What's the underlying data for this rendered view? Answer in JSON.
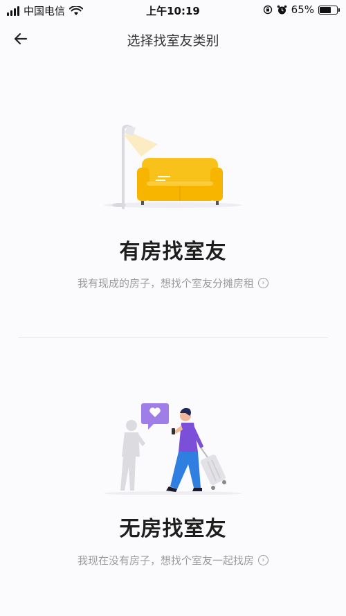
{
  "status_bar": {
    "carrier": "中国电信",
    "time": "上午10:19",
    "battery": "65%",
    "battery_level": 0.65
  },
  "nav": {
    "title": "选择找室友类别",
    "back_icon": "arrow-left-icon"
  },
  "options": [
    {
      "title": "有房找室友",
      "description": "我有现成的房子，想找个室友分摊房租",
      "illustration": "sofa-with-lamp"
    },
    {
      "title": "无房找室友",
      "description": "我现在没有房子，想找个室友一起找房",
      "illustration": "person-with-luggage"
    }
  ],
  "colors": {
    "sofa": "#f7b500",
    "shirt": "#7b4fd8",
    "pants": "#2f7fe0",
    "chat_bubble": "#a07ee8"
  }
}
